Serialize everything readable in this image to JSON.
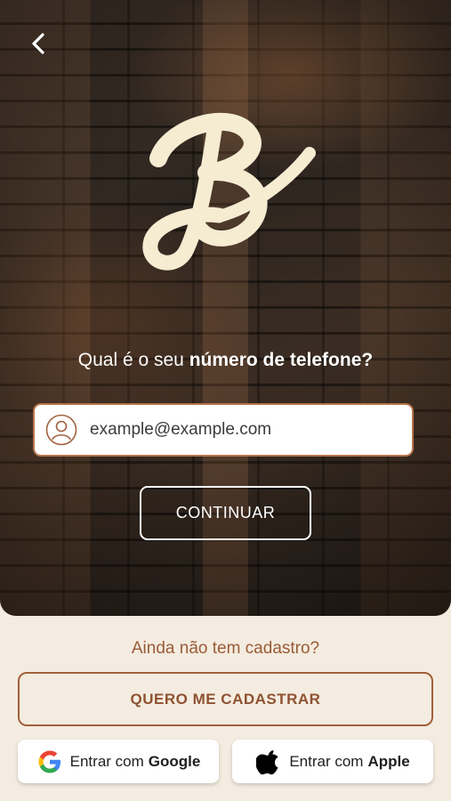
{
  "hero": {
    "back_icon": "chevron-left-icon",
    "logo_icon": "brand-logo-b",
    "question_prefix": "Qual é o seu ",
    "question_bold": "número de telefone?"
  },
  "login_form": {
    "field_icon": "user-icon",
    "input_value": "",
    "input_placeholder": "example@example.com",
    "continue_label": "CONTINUAR"
  },
  "signup": {
    "prompt": "Ainda não tem cadastro?",
    "button_label": "QUERO ME CADASTRAR"
  },
  "social": {
    "google_prefix": "Entrar com",
    "google_brand": "Google",
    "google_icon": "google-icon",
    "apple_prefix": "Entrar com",
    "apple_brand": "Apple",
    "apple_icon": "apple-icon"
  },
  "colors": {
    "accent": "#a0603b",
    "background": "#f4ece0",
    "logo": "#f5ecd2"
  }
}
